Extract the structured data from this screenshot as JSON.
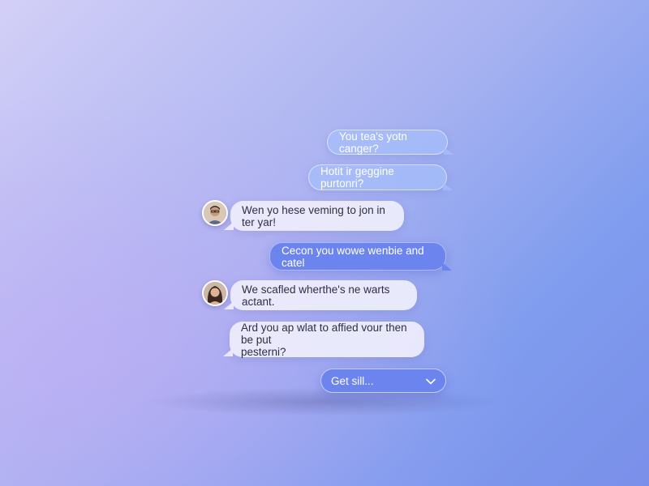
{
  "messages": [
    {
      "text": "You tea's yotn canger?",
      "side": "outgoing",
      "style": "light"
    },
    {
      "text": "Hotit ir geggine purtonri?",
      "side": "outgoing",
      "style": "light"
    },
    {
      "text": "Wen yo hese veming to jon in ter yar!",
      "side": "incoming",
      "avatar": "man-avatar"
    },
    {
      "text": "Cecon you wowe wenbie and catel",
      "side": "outgoing",
      "style": "strong"
    },
    {
      "text": "We scafled wherthe's ne warts actant.",
      "side": "incoming",
      "avatar": "woman-avatar"
    },
    {
      "text": "Ard you ap wlat to affied vour then be put\npesterni?",
      "side": "incoming"
    }
  ],
  "composer": {
    "value": "Get sill...",
    "icon": "chevron-down-icon"
  },
  "colors": {
    "outgoing_strong": "#6c84ee",
    "incoming": "#edecfc"
  }
}
